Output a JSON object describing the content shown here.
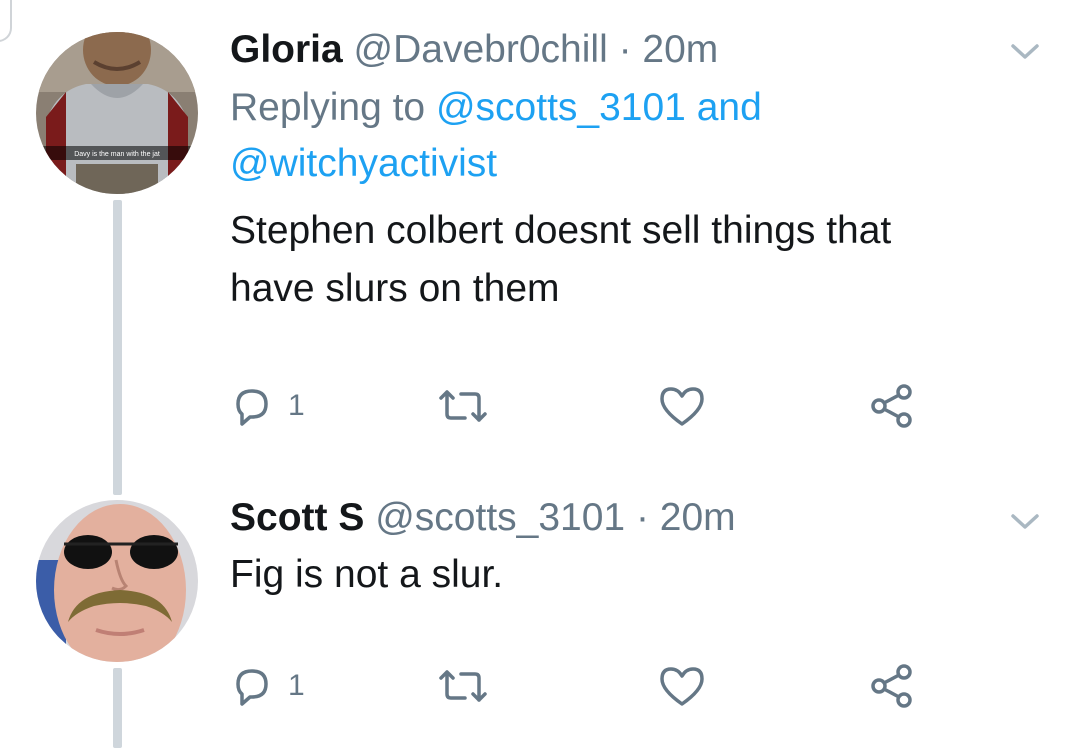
{
  "tweets": [
    {
      "display_name": "Gloria",
      "handle": "@Davebr0chill",
      "time": "· 20m",
      "replying_prefix": "Replying to",
      "replying_to_1": "@scotts_3101",
      "replying_and": "and",
      "replying_to_2": "@witchyactivist",
      "text_line_1": "Stephen colbert doesnt sell things that",
      "text_line_2": "have slurs on them",
      "avatar_caption": "Davy is the man with the jat",
      "reply_count": "1",
      "icons": [
        "reply-icon",
        "retweet-icon",
        "like-icon",
        "share-icon",
        "chevron-down-icon"
      ]
    },
    {
      "display_name": "Scott S",
      "handle": "@scotts_3101",
      "time": "· 20m",
      "text_line_1": "Fig is not a slur.",
      "reply_count": "1",
      "icons": [
        "reply-icon",
        "retweet-icon",
        "like-icon",
        "share-icon",
        "chevron-down-icon"
      ]
    }
  ],
  "colors": {
    "primary_text": "#14171a",
    "secondary_text": "#657786",
    "link": "#1da1f2",
    "thread_line": "#cfd6dc",
    "icon": "#657786"
  }
}
